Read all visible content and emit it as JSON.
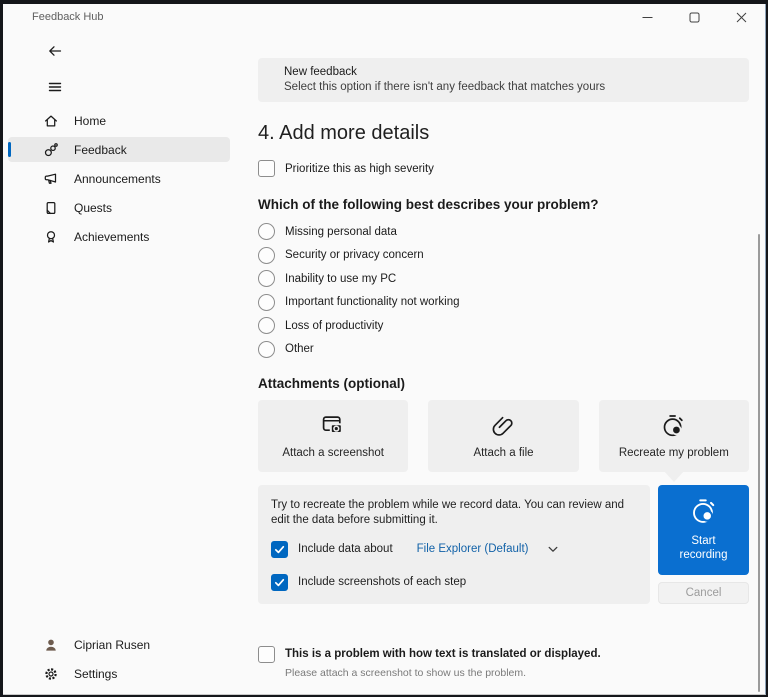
{
  "window": {
    "title": "Feedback Hub"
  },
  "colors": {
    "accent": "#0067c0",
    "button_blue": "#0a6fd0",
    "link_blue": "#1262a8"
  },
  "sidebar": {
    "nav": [
      {
        "label": "Home",
        "icon": "home-icon",
        "selected": false
      },
      {
        "label": "Feedback",
        "icon": "feedback-icon",
        "selected": true
      },
      {
        "label": "Announcements",
        "icon": "megaphone-icon",
        "selected": false
      },
      {
        "label": "Quests",
        "icon": "quests-icon",
        "selected": false
      },
      {
        "label": "Achievements",
        "icon": "medal-icon",
        "selected": false
      }
    ],
    "footer": [
      {
        "label": "Ciprian Rusen",
        "icon": "avatar"
      },
      {
        "label": "Settings",
        "icon": "gear-icon"
      }
    ]
  },
  "main": {
    "banner": {
      "title": "New feedback",
      "subtitle": "Select this option if there isn't any feedback that matches yours"
    },
    "heading": "4. Add more details",
    "severity_checkbox": {
      "label": "Prioritize this as high severity",
      "checked": false
    },
    "problem_section": {
      "heading": "Which of the following best describes your problem?",
      "options": [
        "Missing personal data",
        "Security or privacy concern",
        "Inability to use my PC",
        "Important functionality not working",
        "Loss of productivity",
        "Other"
      ]
    },
    "attachments": {
      "heading": "Attachments (optional)",
      "cards": [
        {
          "label": "Attach a screenshot",
          "icon": "screenshot-icon"
        },
        {
          "label": "Attach a file",
          "icon": "paperclip-icon"
        },
        {
          "label": "Recreate my problem",
          "icon": "stopwatch-icon"
        }
      ]
    },
    "recording": {
      "description": "Try to recreate the problem while we record data. You can review and edit the data before submitting it.",
      "include_data": {
        "label": "Include data about",
        "checked": true,
        "value": "File Explorer (Default)"
      },
      "include_screenshots": {
        "label": "Include screenshots of each step",
        "checked": true
      },
      "start_button": {
        "label": "Start recording"
      },
      "cancel_button": {
        "label": "Cancel"
      }
    },
    "translation_checkbox": {
      "label": "This is a problem with how text is translated or displayed.",
      "hint": "Please attach a screenshot to show us the problem.",
      "checked": false
    }
  }
}
